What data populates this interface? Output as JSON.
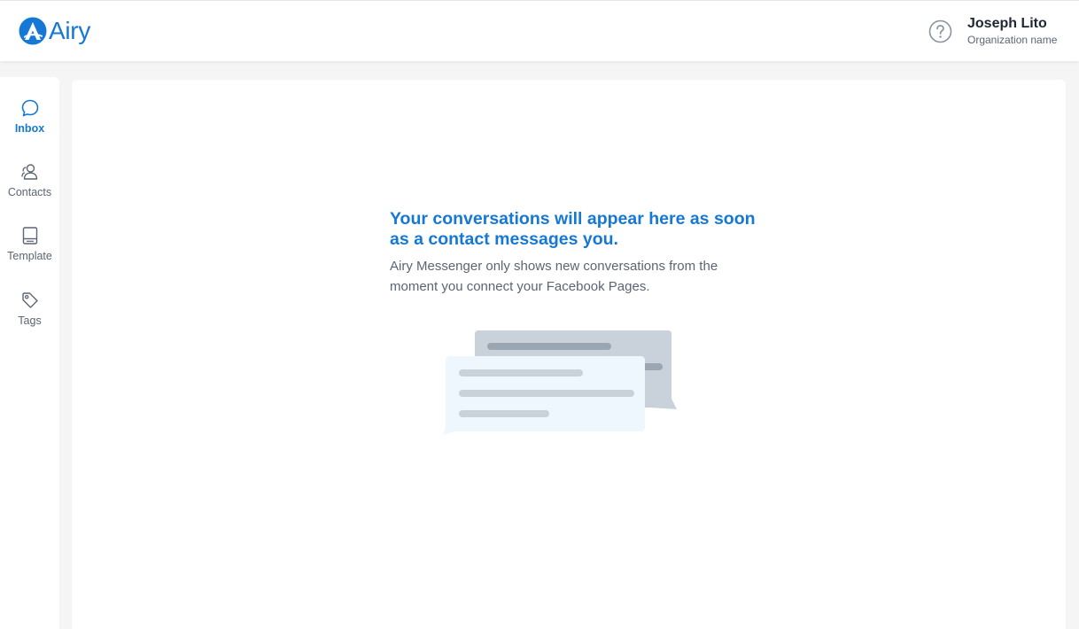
{
  "app": {
    "logo_text": "Airy",
    "brand_color": "#1578d4"
  },
  "header": {
    "help_icon": "question-circle-icon",
    "user": {
      "name": "Joseph Lito",
      "organization": "Organization name"
    }
  },
  "sidebar": {
    "items": [
      {
        "label": "Inbox",
        "icon": "chat-bubble-icon",
        "active": true
      },
      {
        "label": "Contacts",
        "icon": "contacts-icon",
        "active": false
      },
      {
        "label": "Template",
        "icon": "template-icon",
        "active": false
      },
      {
        "label": "Tags",
        "icon": "tag-icon",
        "active": false
      }
    ]
  },
  "main": {
    "empty_state": {
      "title": "Your conversations will appear here as soon as a contact messages you.",
      "body": "Airy Messenger only shows new conversations from the moment you connect your Facebook Pages.",
      "illustration": "chat-bubbles-illustration"
    }
  }
}
